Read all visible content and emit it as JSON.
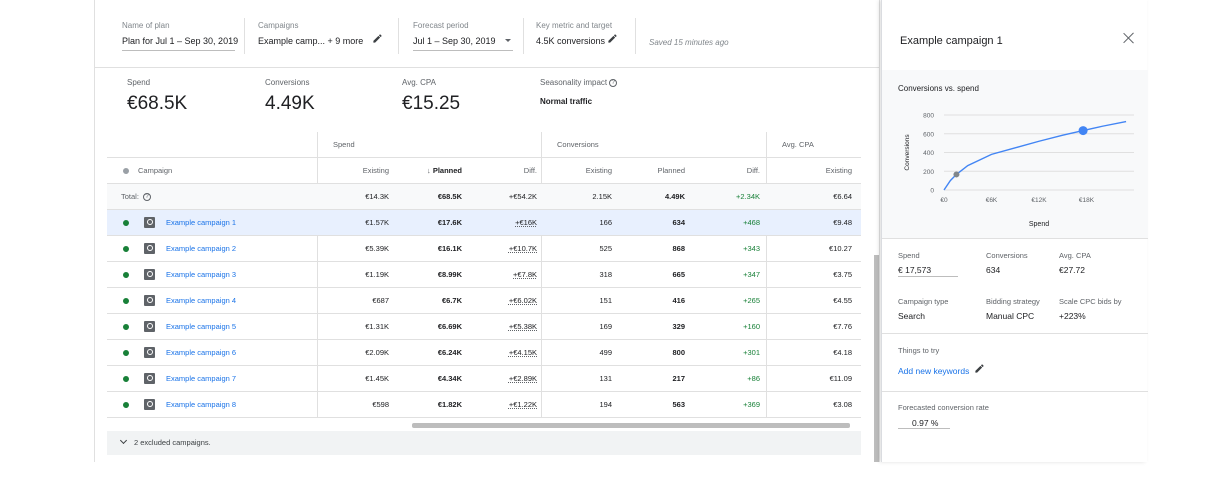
{
  "header": {
    "plan_label": "Name of plan",
    "plan_value": "Plan for Jul 1 – Sep 30, 2019",
    "campaigns_label": "Campaigns",
    "campaigns_value": "Example camp... + 9 more",
    "forecast_label": "Forecast period",
    "forecast_value": "Jul 1 – Sep 30, 2019",
    "metric_label": "Key metric and target",
    "metric_value": "4.5K conversions",
    "saved_text": "Saved 15 minutes ago"
  },
  "summary": {
    "spend_label": "Spend",
    "spend_value": "€68.5K",
    "conv_label": "Conversions",
    "conv_value": "4.49K",
    "cpa_label": "Avg. CPA",
    "cpa_value": "€15.25",
    "season_label": "Seasonality impact",
    "season_value": "Normal traffic"
  },
  "table": {
    "group_headers": {
      "spend": "Spend",
      "conversions": "Conversions",
      "cpa": "Avg. CPA"
    },
    "columns": {
      "campaign": "Campaign",
      "existing": "Existing",
      "planned": "Planned",
      "diff": "Diff.",
      "conv_existing": "Existing",
      "conv_planned": "Planned",
      "conv_diff": "Diff.",
      "cpa_existing": "Existing"
    },
    "sort_arrow": "↓",
    "total": {
      "label": "Total:",
      "spend_existing": "€14.3K",
      "spend_planned": "€68.5K",
      "spend_diff": "+€54.2K",
      "conv_existing": "2.15K",
      "conv_planned": "4.49K",
      "conv_diff": "+2.34K",
      "cpa_existing": "€6.64"
    },
    "rows": [
      {
        "name": "Example campaign 1",
        "spend_existing": "€1.57K",
        "spend_planned": "€17.6K",
        "spend_diff": "+€16K",
        "conv_existing": "166",
        "conv_planned": "634",
        "conv_diff": "+468",
        "cpa_existing": "€9.48"
      },
      {
        "name": "Example campaign 2",
        "spend_existing": "€5.39K",
        "spend_planned": "€16.1K",
        "spend_diff": "+€10.7K",
        "conv_existing": "525",
        "conv_planned": "868",
        "conv_diff": "+343",
        "cpa_existing": "€10.27"
      },
      {
        "name": "Example campaign 3",
        "spend_existing": "€1.19K",
        "spend_planned": "€8.99K",
        "spend_diff": "+€7.8K",
        "conv_existing": "318",
        "conv_planned": "665",
        "conv_diff": "+347",
        "cpa_existing": "€3.75"
      },
      {
        "name": "Example campaign 4",
        "spend_existing": "€687",
        "spend_planned": "€6.7K",
        "spend_diff": "+€6.02K",
        "conv_existing": "151",
        "conv_planned": "416",
        "conv_diff": "+265",
        "cpa_existing": "€4.55"
      },
      {
        "name": "Example campaign 5",
        "spend_existing": "€1.31K",
        "spend_planned": "€6.69K",
        "spend_diff": "+€5.38K",
        "conv_existing": "169",
        "conv_planned": "329",
        "conv_diff": "+160",
        "cpa_existing": "€7.76"
      },
      {
        "name": "Example campaign 6",
        "spend_existing": "€2.09K",
        "spend_planned": "€6.24K",
        "spend_diff": "+€4.15K",
        "conv_existing": "499",
        "conv_planned": "800",
        "conv_diff": "+301",
        "cpa_existing": "€4.18"
      },
      {
        "name": "Example campaign 7",
        "spend_existing": "€1.45K",
        "spend_planned": "€4.34K",
        "spend_diff": "+€2.89K",
        "conv_existing": "131",
        "conv_planned": "217",
        "conv_diff": "+86",
        "cpa_existing": "€11.09"
      },
      {
        "name": "Example campaign 8",
        "spend_existing": "€598",
        "spend_planned": "€1.82K",
        "spend_diff": "+€1.22K",
        "conv_existing": "194",
        "conv_planned": "563",
        "conv_diff": "+369",
        "cpa_existing": "€3.08"
      }
    ],
    "excluded_text": "2 excluded campaigns."
  },
  "side": {
    "title": "Example campaign 1",
    "spend_label": "Spend",
    "spend_value": "€ 17,573",
    "conv_label": "Conversions",
    "conv_value": "634",
    "cpa_label": "Avg. CPA",
    "cpa_value": "€27.72",
    "type_label": "Campaign type",
    "type_value": "Search",
    "bid_label": "Bidding strategy",
    "bid_value": "Manual CPC",
    "scale_label": "Scale CPC bids by",
    "scale_value": "+223%",
    "things_label": "Things to try",
    "add_keywords": "Add new keywords",
    "rate_label": "Forecasted conversion rate",
    "rate_value": "0.97 %"
  },
  "chart_data": {
    "type": "line",
    "title": "Conversions vs. spend",
    "xlabel": "Spend",
    "ylabel": "Conversions",
    "x_ticks": [
      "€0",
      "€6K",
      "€12K",
      "€18K"
    ],
    "y_ticks": [
      "0",
      "200",
      "400",
      "600",
      "800"
    ],
    "xlim": [
      0,
      24000
    ],
    "ylim": [
      0,
      800
    ],
    "series": [
      {
        "x": [
          0,
          800,
          1570,
          3000,
          6000,
          9000,
          12000,
          15000,
          17573,
          20000,
          23000
        ],
        "y": [
          0,
          100,
          166,
          260,
          380,
          450,
          520,
          585,
          634,
          680,
          730
        ]
      }
    ],
    "points": [
      {
        "x": 1570,
        "y": 166,
        "color": "#80868b"
      },
      {
        "x": 17573,
        "y": 634,
        "color": "#4285f4"
      }
    ],
    "line_color": "#4285f4"
  }
}
